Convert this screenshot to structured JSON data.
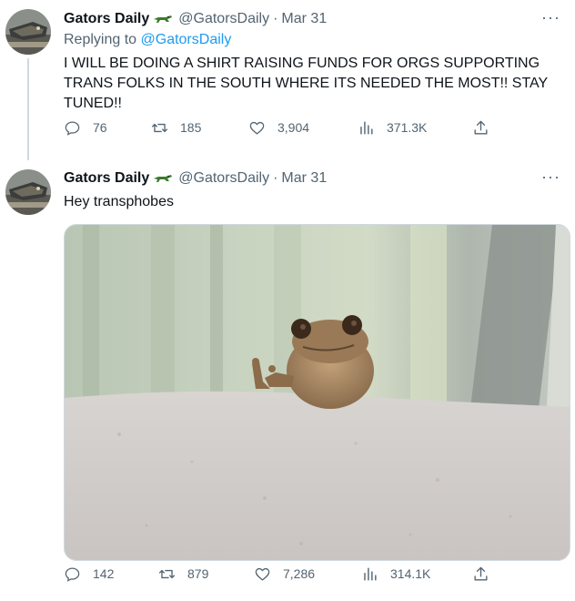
{
  "tweets": [
    {
      "author_name": "Gators Daily",
      "handle": "@GatorsDaily",
      "separator": "·",
      "date": "Mar 31",
      "replying_prefix": "Replying to ",
      "replying_to": "@GatorsDaily",
      "text": "I WILL BE DOING A SHIRT RAISING FUNDS FOR ORGS SUPPORTING TRANS FOLKS IN THE SOUTH WHERE ITS NEEDED THE MOST!! STAY TUNED!!",
      "replies": "76",
      "retweets": "185",
      "likes": "3,904",
      "views": "371.3K",
      "more": "···"
    },
    {
      "author_name": "Gators Daily",
      "handle": "@GatorsDaily",
      "separator": "·",
      "date": "Mar 31",
      "text": "Hey transphobes",
      "replies": "142",
      "retweets": "879",
      "likes": "7,286",
      "views": "314.1K",
      "more": "···"
    }
  ],
  "colors": {
    "text": "#0f1419",
    "muted": "#536471",
    "link": "#1d9bf0",
    "border": "#cfd9de",
    "gator_green": "#3a7d2c"
  },
  "icons": [
    "gator-emoji-icon",
    "more-icon",
    "reply-icon",
    "retweet-icon",
    "like-icon",
    "views-icon",
    "share-icon"
  ]
}
